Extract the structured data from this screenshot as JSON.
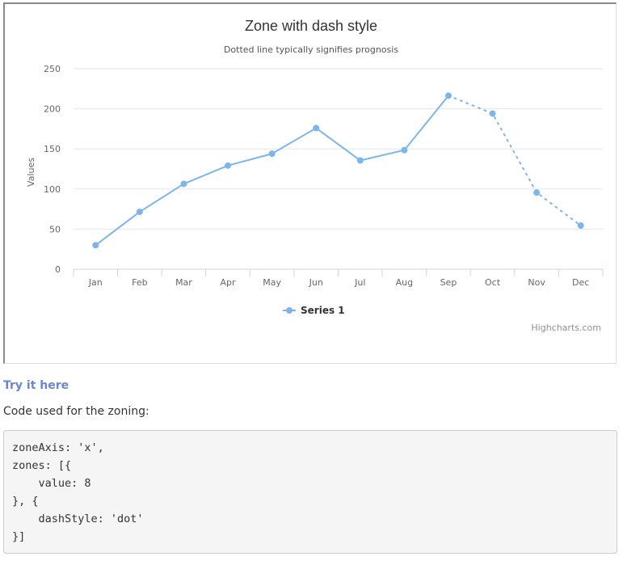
{
  "chart_data": {
    "type": "line",
    "title": "Zone with dash style",
    "subtitle": "Dotted line typically signifies prognosis",
    "xlabel": "",
    "ylabel": "Values",
    "categories": [
      "Jan",
      "Feb",
      "Mar",
      "Apr",
      "May",
      "Jun",
      "Jul",
      "Aug",
      "Sep",
      "Oct",
      "Nov",
      "Dec"
    ],
    "y_ticks": [
      "0",
      "50",
      "100",
      "150",
      "200",
      "250"
    ],
    "ylim": [
      0,
      250
    ],
    "grid": true,
    "legend_position": "bottom-center",
    "series": [
      {
        "name": "Series 1",
        "values": [
          29.9,
          71.5,
          106.4,
          129.2,
          144.0,
          176.0,
          135.6,
          148.5,
          216.4,
          194.1,
          95.6,
          54.4
        ],
        "color": "#7cb5ec",
        "zones": [
          {
            "up_to_index": 8,
            "dash_style": "solid"
          },
          {
            "from_index": 8,
            "dash_style": "dot"
          }
        ]
      }
    ],
    "credits": "Highcharts.com"
  },
  "colors": {
    "series": "#7cb5ec",
    "grid": "#e6e6e6",
    "axis_text": "#666666",
    "title_text": "#333333",
    "link": "#6b86cc"
  },
  "links": {
    "try_it": "Try it here"
  },
  "text": {
    "code_intro": "Code used for the zoning:"
  },
  "code": {
    "snippet": "zoneAxis: 'x',\nzones: [{\n    value: 8\n}, {\n    dashStyle: 'dot'\n}]"
  }
}
